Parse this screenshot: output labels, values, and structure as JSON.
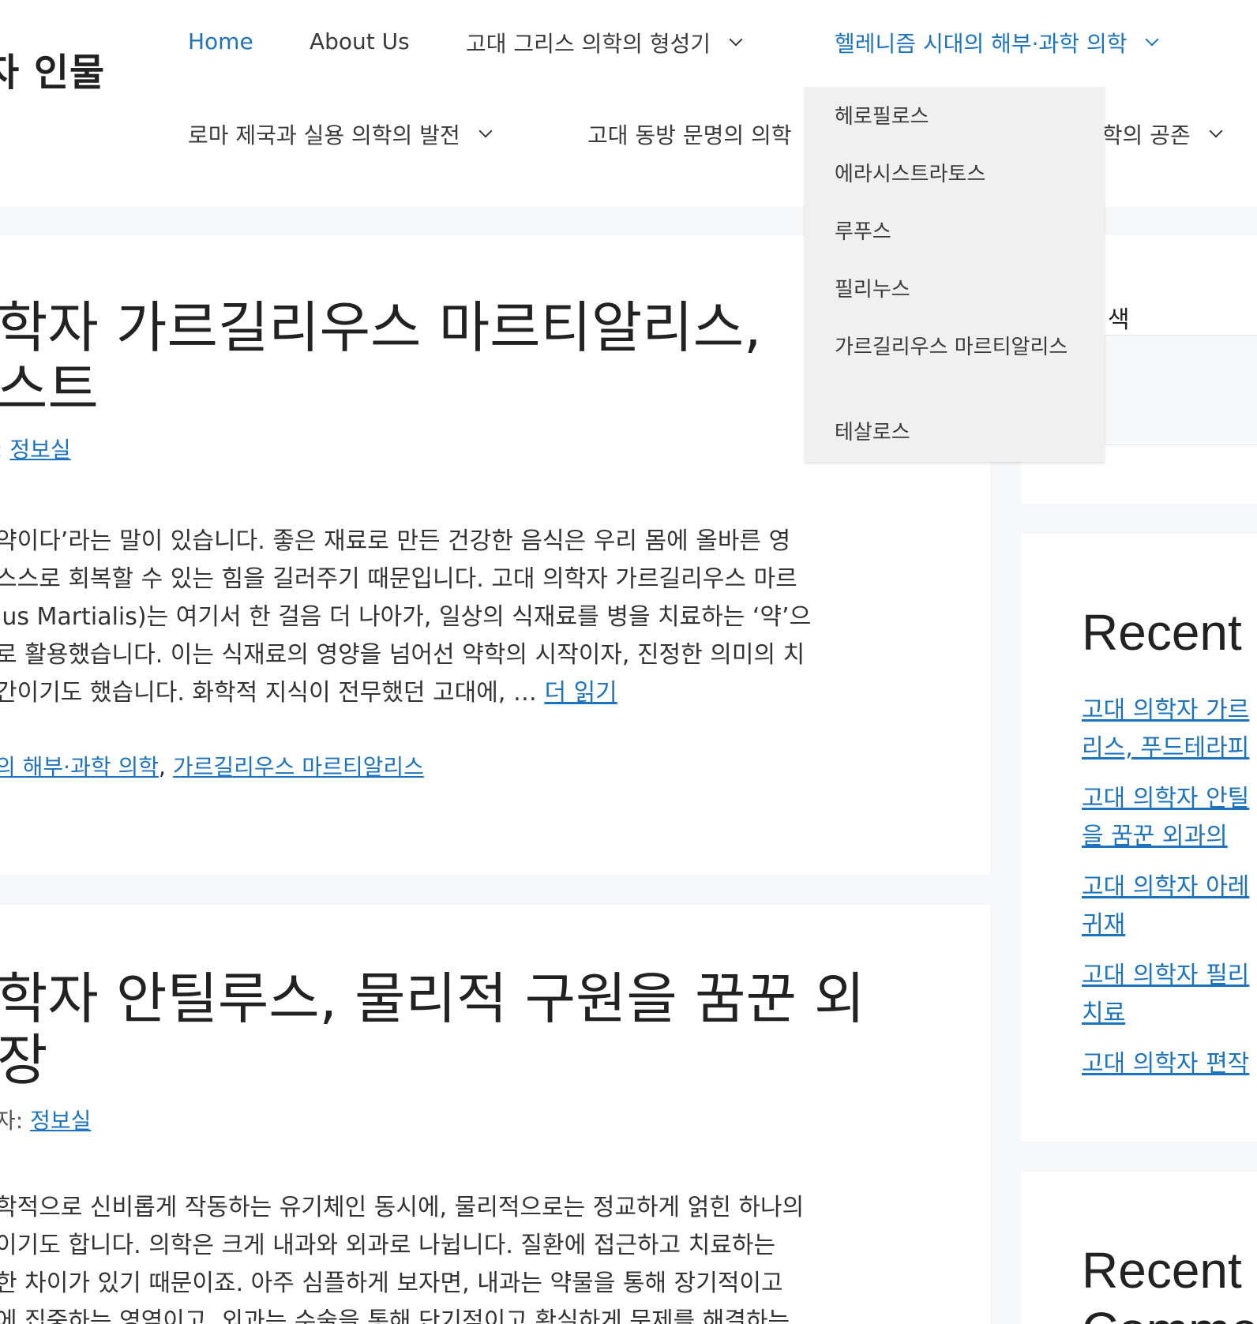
{
  "site": {
    "title": "자 인물"
  },
  "nav": {
    "home": "Home",
    "about": "About Us",
    "greek": "고대 그리스 의학의 형성기",
    "hellenism": "헬레니즘 시대의 해부·과학 의학",
    "rome": "로마 제국과 실용 의학의 발전",
    "east": "고대 동방 문명의 의학",
    "coexist": "의학의 공존"
  },
  "dropdown": {
    "items": [
      "헤로필로스",
      "에라시스트라토스",
      "루푸스",
      "필리누스",
      "가르길리우스 마르티알리스",
      "테살로스"
    ]
  },
  "posts": [
    {
      "title_lines": [
        "학자 가르길리우스 마르티알리스, ",
        "스트"
      ],
      "meta_prefix": ":",
      "author": "정보실",
      "excerpt_lines": [
        "약이다’라는 말이 있습니다. 좋은 재료로 만든 건강한 음식은 우리 몸에 올바른 영",
        "스스로 회복할 수 있는 힘을 길러주기 때문입니다. 고대 의학자 가르길리우스 마르",
        "ius Martialis)는 여기서 한 걸음 더 나아가, 일상의 식재료를 병을 치료하는 ‘약’으",
        "로 활용했습니다. 이는 식재료의 영양을 넘어선 약학의 시작이자, 진정한 의미의 치",
        "간이기도 했습니다. 화학적 지식이 전무했던 고대에, …"
      ],
      "read_more": "더 읽기",
      "cat1": "의 해부·과학 의학",
      "cat_sep": ",",
      "cat2": "가르길리우스 마르티알리스"
    },
    {
      "title_lines": [
        "학자 안틸루스, 물리적 구원을 꿈꾼 외",
        "장"
      ],
      "meta_prefix": "자:",
      "author": "정보실",
      "excerpt_lines": [
        "학적으로 신비롭게 작동하는 유기체인 동시에, 물리적으로는 정교하게 얽힌 하나의",
        "이기도 합니다. 의학은 크게 내과와 외과로 나뉩니다. 질환에 접근하고 치료하는",
        "한 차이가 있기 때문이죠. 아주 심플하게 보자면, 내과는 약물을 통해 장기적이고",
        "에 집중하는 영역이고, 외과는 수술을 통해 단기적이고 확실하게 문제를 해결하는"
      ]
    }
  ],
  "sidebar": {
    "search_label": "색",
    "recent_title": "Recent",
    "recent_links": [
      "고대 의학자 가르",
      "리스, 푸드테라피",
      "고대 의학자 안틸",
      "을 꿈꾼 외과의",
      "고대 의학자 아레",
      "귀재",
      "고대 의학자 필리",
      "치료",
      "고대 의학자 편작"
    ],
    "recent_comments_title": "Recent",
    "recent_comments_title2": "Comme"
  }
}
